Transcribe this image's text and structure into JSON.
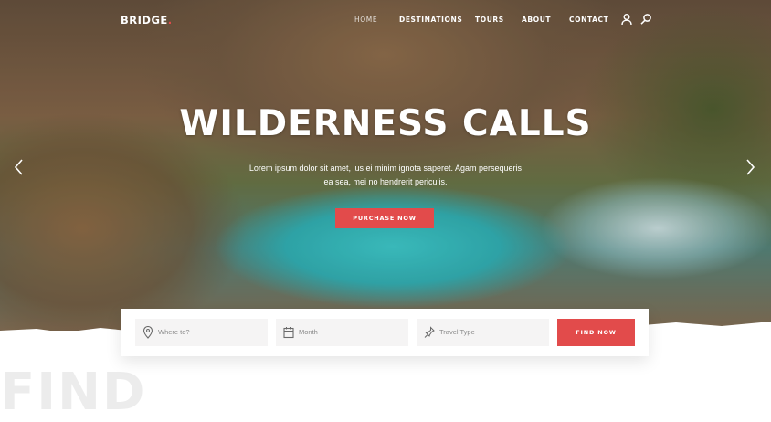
{
  "brand": {
    "name": "BRIDGE",
    "dot": ".",
    "accent": "#e24b4b"
  },
  "nav": {
    "items": [
      "HOME",
      "DESTINATIONS",
      "TOURS",
      "ABOUT",
      "CONTACT"
    ],
    "active": "HOME"
  },
  "header_icons": [
    "user-icon",
    "search-icon"
  ],
  "hero": {
    "title": "WILDERNESS CALLS",
    "subtitle": "Lorem ipsum dolor sit amet, ius ei minim ignota saperet. Agam persequeris ea sea, mei no hendrerit periculis.",
    "cta_label": "PURCHASE NOW",
    "prev_icon": "chevron-left-icon",
    "next_icon": "chevron-right-icon"
  },
  "search": {
    "where": {
      "placeholder": "Where to?",
      "icon": "map-pin-icon"
    },
    "month": {
      "placeholder": "Month",
      "icon": "calendar-icon"
    },
    "travel_type": {
      "placeholder": "Travel Type",
      "icon": "pin-icon"
    },
    "button_label": "FIND NOW"
  },
  "section": {
    "big_word": "FIND"
  }
}
